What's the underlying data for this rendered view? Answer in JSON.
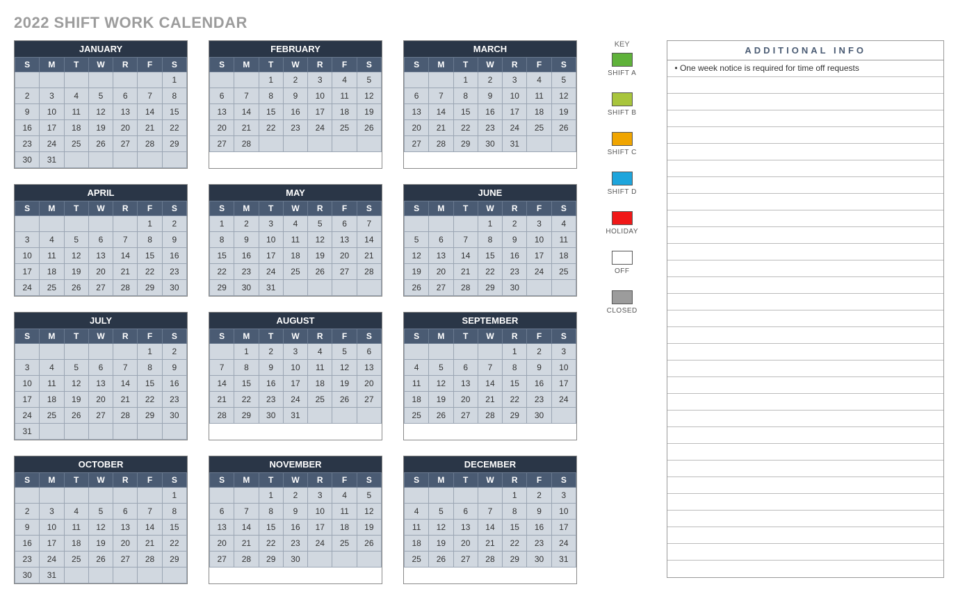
{
  "title": "2022 SHIFT WORK CALENDAR",
  "day_headers": [
    "S",
    "M",
    "T",
    "W",
    "R",
    "F",
    "S"
  ],
  "months": [
    {
      "name": "JANUARY",
      "start": 6,
      "days": 31
    },
    {
      "name": "FEBRUARY",
      "start": 2,
      "days": 28
    },
    {
      "name": "MARCH",
      "start": 2,
      "days": 31
    },
    {
      "name": "APRIL",
      "start": 5,
      "days": 30
    },
    {
      "name": "MAY",
      "start": 0,
      "days": 31
    },
    {
      "name": "JUNE",
      "start": 3,
      "days": 30
    },
    {
      "name": "JULY",
      "start": 5,
      "days": 31
    },
    {
      "name": "AUGUST",
      "start": 1,
      "days": 31
    },
    {
      "name": "SEPTEMBER",
      "start": 4,
      "days": 30
    },
    {
      "name": "OCTOBER",
      "start": 6,
      "days": 31
    },
    {
      "name": "NOVEMBER",
      "start": 2,
      "days": 30
    },
    {
      "name": "DECEMBER",
      "start": 4,
      "days": 31
    }
  ],
  "key": {
    "heading": "KEY",
    "items": [
      {
        "label": "SHIFT A",
        "color": "#5fb23a"
      },
      {
        "label": "SHIFT B",
        "color": "#a8c53c"
      },
      {
        "label": "SHIFT C",
        "color": "#f0a500"
      },
      {
        "label": "SHIFT D",
        "color": "#1ea5dc"
      },
      {
        "label": "HOLIDAY",
        "color": "#f01818"
      },
      {
        "label": "OFF",
        "color": "#ffffff"
      },
      {
        "label": "CLOSED",
        "color": "#9c9c9c"
      }
    ]
  },
  "info": {
    "heading": "ADDITIONAL INFO",
    "rows": [
      "• One week notice is required for time off requests",
      "",
      "",
      "",
      "",
      "",
      "",
      "",
      "",
      "",
      "",
      "",
      "",
      "",
      "",
      "",
      "",
      "",
      "",
      "",
      "",
      "",
      "",
      "",
      "",
      "",
      "",
      "",
      "",
      "",
      ""
    ]
  }
}
